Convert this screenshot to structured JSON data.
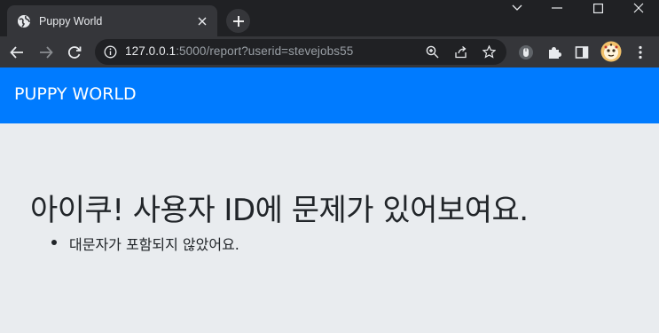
{
  "browser": {
    "tab": {
      "title": "Puppy World",
      "favicon": "globe-icon"
    },
    "address": {
      "host": "127.0.0.1",
      "path": ":5000/report?userid=stevejobs55"
    }
  },
  "navbar": {
    "brand": "PUPPY WORLD"
  },
  "main": {
    "heading": "아이쿠! 사용자 ID에 문제가 있어보여요.",
    "errors": [
      "대문자가 포함되지 않았어요."
    ]
  },
  "colors": {
    "navbar": "#007bff",
    "page_bg": "#e9ecef",
    "text": "#212529"
  }
}
